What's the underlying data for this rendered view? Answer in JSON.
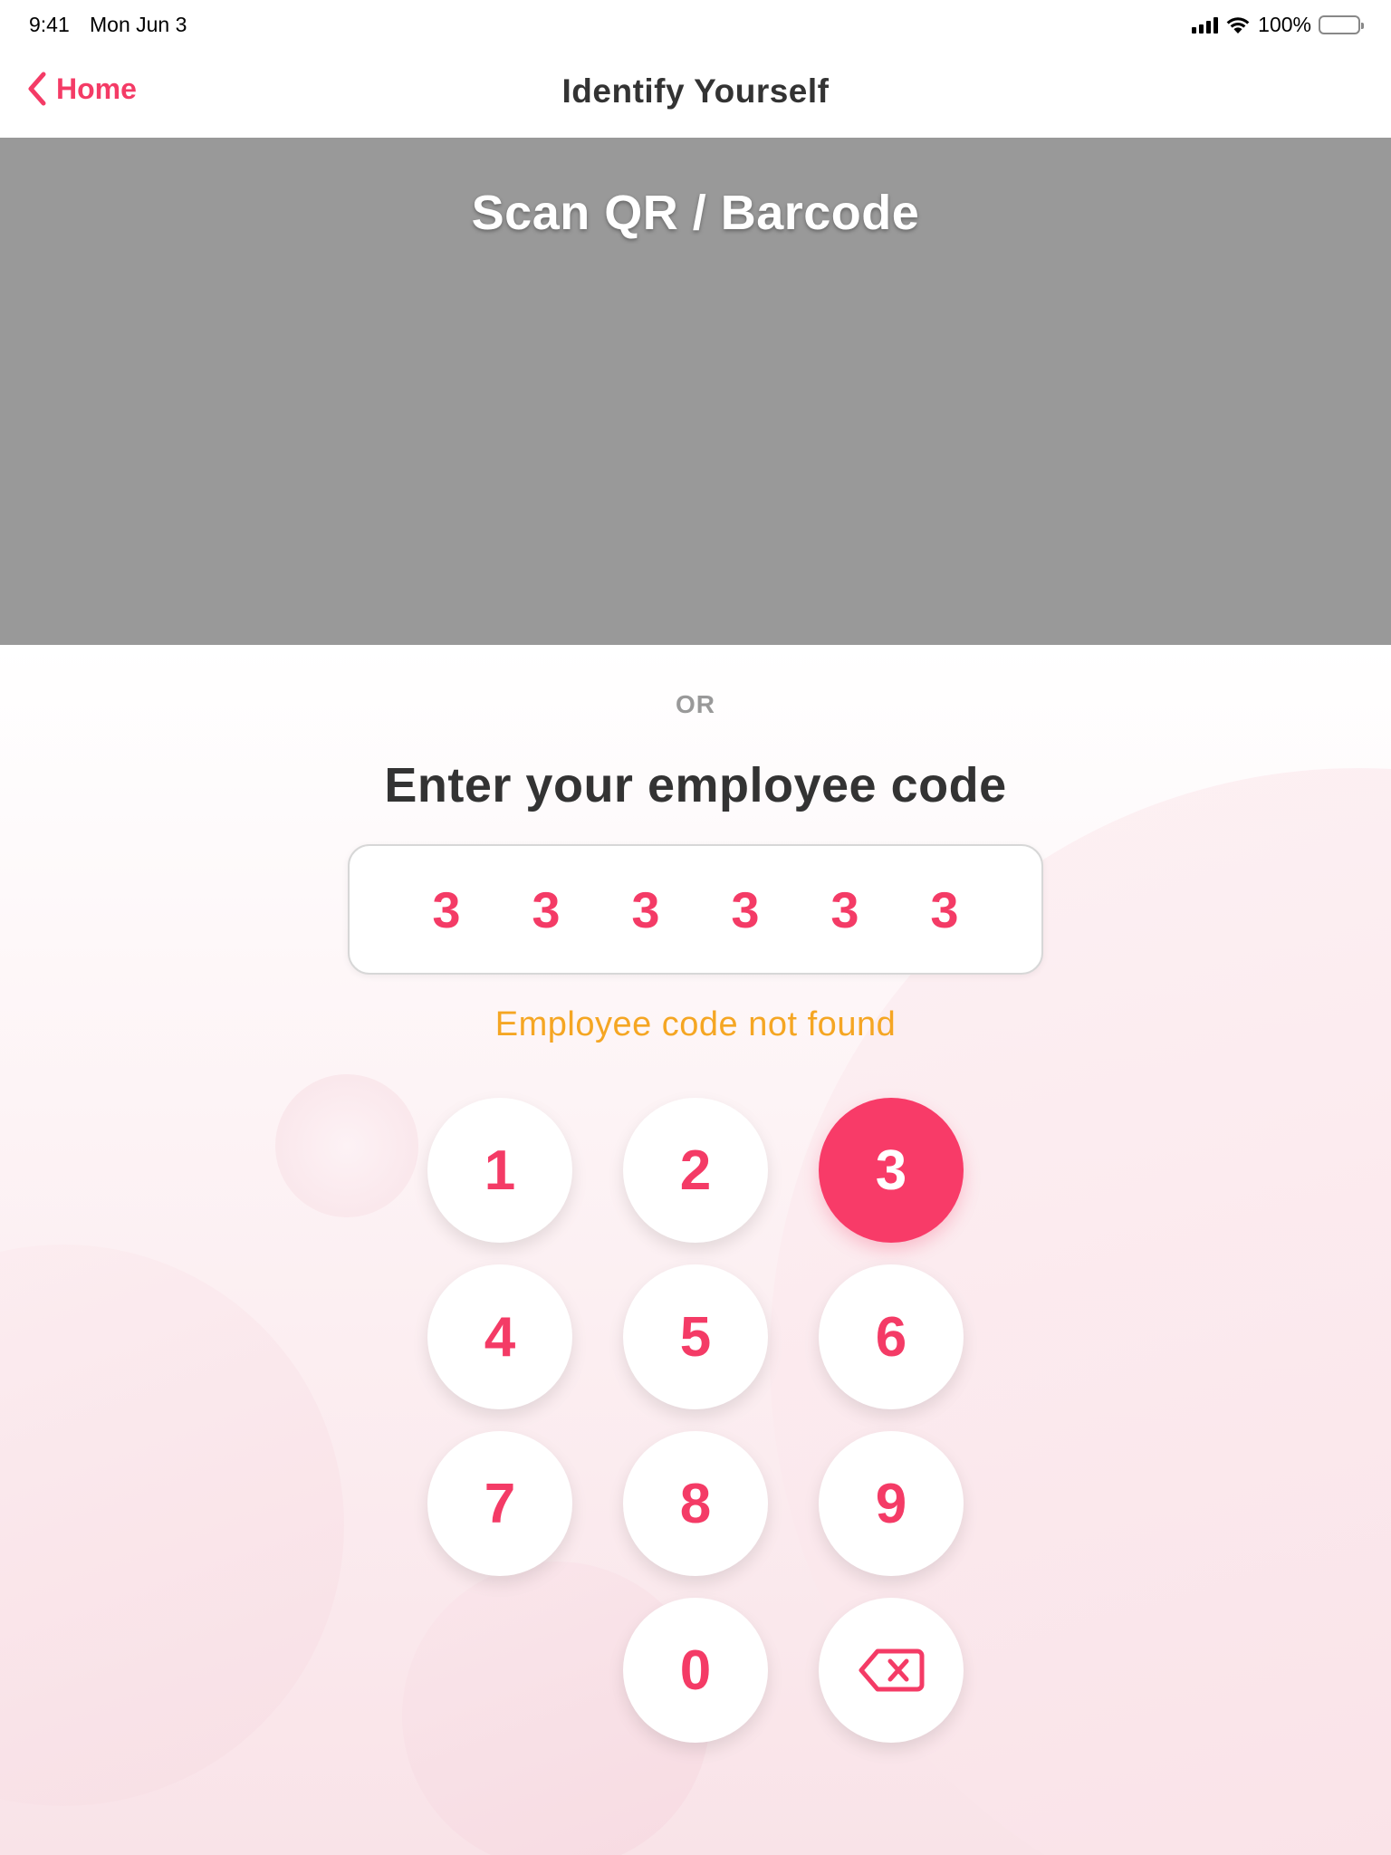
{
  "status_bar": {
    "time": "9:41",
    "date": "Mon Jun 3",
    "battery": "100%"
  },
  "nav": {
    "back_label": "Home",
    "title": "Identify Yourself"
  },
  "scanner": {
    "title": "Scan QR / Barcode"
  },
  "or_label": "OR",
  "prompt": "Enter your employee code",
  "code_digits": [
    "3",
    "3",
    "3",
    "3",
    "3",
    "3"
  ],
  "error_message": "Employee code not found",
  "keypad": {
    "k1": "1",
    "k2": "2",
    "k3": "3",
    "k4": "4",
    "k5": "5",
    "k6": "6",
    "k7": "7",
    "k8": "8",
    "k9": "9",
    "k0": "0",
    "active_key": "3",
    "backspace_icon": "delete-backspace-icon"
  },
  "colors": {
    "accent": "#f43b66",
    "error": "#f5a623",
    "scanner_bg": "#999999"
  }
}
